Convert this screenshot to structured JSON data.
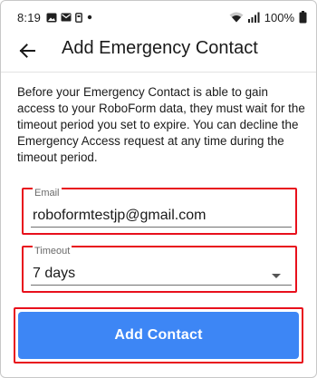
{
  "status_bar": {
    "time": "8:19",
    "battery": "100%",
    "icons": [
      "photo-icon",
      "mail-icon",
      "sim-icon",
      "dot-icon",
      "wifi-icon",
      "signal-icon",
      "battery-icon"
    ]
  },
  "app_bar": {
    "title": "Add Emergency Contact",
    "back_icon": "arrow-left-icon"
  },
  "description": "Before your Emergency Contact is able to gain access to your RoboForm data, they must wait for the timeout period you set to expire. You can decline the Emergency Access request at any time during the timeout period.",
  "email_field": {
    "label": "Email",
    "value": "roboformtestjp@gmail.com"
  },
  "timeout_field": {
    "label": "Timeout",
    "value": "7 days",
    "icon": "dropdown-arrow-icon"
  },
  "add_button": {
    "label": "Add Contact"
  },
  "colors": {
    "accent": "#3d86f5",
    "highlight": "#e8101c"
  }
}
